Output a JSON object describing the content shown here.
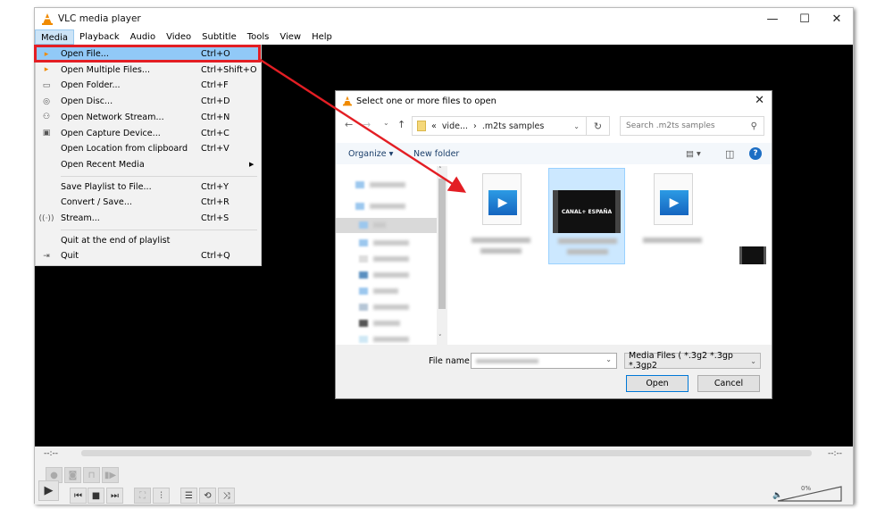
{
  "window": {
    "title": "VLC media player",
    "controls": {
      "minimize": "—",
      "maximize": "☐",
      "close": "✕"
    }
  },
  "menubar": [
    {
      "label": "Media",
      "active": true
    },
    {
      "label": "Playback"
    },
    {
      "label": "Audio"
    },
    {
      "label": "Video"
    },
    {
      "label": "Subtitle"
    },
    {
      "label": "Tools"
    },
    {
      "label": "View"
    },
    {
      "label": "Help"
    }
  ],
  "media_menu": [
    {
      "label": "Open File...",
      "shortcut": "Ctrl+O",
      "icon": "file-play-icon",
      "glyph": "▸",
      "highlighted": true
    },
    {
      "label": "Open Multiple Files...",
      "shortcut": "Ctrl+Shift+O",
      "icon": "files-play-icon",
      "glyph": "▸"
    },
    {
      "label": "Open Folder...",
      "shortcut": "Ctrl+F",
      "icon": "folder-icon",
      "glyph": "▭"
    },
    {
      "label": "Open Disc...",
      "shortcut": "Ctrl+D",
      "icon": "disc-icon",
      "glyph": "◎"
    },
    {
      "label": "Open Network Stream...",
      "shortcut": "Ctrl+N",
      "icon": "network-icon",
      "glyph": "⚇"
    },
    {
      "label": "Open Capture Device...",
      "shortcut": "Ctrl+C",
      "icon": "capture-device-icon",
      "glyph": "▣"
    },
    {
      "label": "Open Location from clipboard",
      "shortcut": "Ctrl+V",
      "icon": "",
      "glyph": ""
    },
    {
      "label": "Open Recent Media",
      "shortcut": "",
      "icon": "",
      "glyph": "",
      "submenu": true
    },
    {
      "separator": true
    },
    {
      "label": "Save Playlist to File...",
      "shortcut": "Ctrl+Y",
      "icon": "",
      "glyph": ""
    },
    {
      "label": "Convert / Save...",
      "shortcut": "Ctrl+R",
      "icon": "",
      "glyph": ""
    },
    {
      "label": "Stream...",
      "shortcut": "Ctrl+S",
      "icon": "stream-icon",
      "glyph": "((·))"
    },
    {
      "separator": true
    },
    {
      "label": "Quit at the end of playlist",
      "shortcut": "",
      "icon": "",
      "glyph": ""
    },
    {
      "label": "Quit",
      "shortcut": "Ctrl+Q",
      "icon": "quit-icon",
      "glyph": "⇥"
    }
  ],
  "submenu_arrow": "▶",
  "dialog": {
    "title": "Select one or more files to open",
    "close": "✕",
    "nav": {
      "back": "←",
      "forward": "→",
      "recent": "⌄",
      "up": "↑"
    },
    "address": {
      "prefix": "«",
      "crumb1": "vide...",
      "sep": "›",
      "crumb2": ".m2ts samples",
      "chevron": "⌄"
    },
    "refresh": "↻",
    "search_placeholder": "Search .m2ts samples",
    "search_glyph": "⚲",
    "toolbar": {
      "organize": "Organize ▾",
      "new_folder": "New folder",
      "view": "▤ ▾",
      "pane": "◫",
      "help": "?"
    },
    "sidebar": {
      "scroll_up": "˄",
      "scroll_down": "˅"
    },
    "files": [
      {
        "type": "video-file",
        "selected": false
      },
      {
        "type": "video-thumbnail",
        "selected": true,
        "thumbnail_text": "CANAL+ ESPAÑA"
      },
      {
        "type": "video-file",
        "selected": false
      },
      {
        "type": "video-thumbnail-small",
        "selected": false
      }
    ],
    "file_name_label": "File name:",
    "file_type_value": "Media Files ( *.3g2 *.3gp *.3gp2",
    "chevron": "⌄",
    "open_label": "Open",
    "cancel_label": "Cancel"
  },
  "player": {
    "time_elapsed": "--:--",
    "time_total": "--:--",
    "volume_label": "0%",
    "buttons": {
      "record": "●",
      "snapshot": "◙",
      "loop_ab": "⊓",
      "frame": "▮▶",
      "play": "▶",
      "prev": "⏮",
      "stop": "■",
      "next": "⏭",
      "fullscreen": "⛶",
      "ext_settings": "⫶",
      "playlist": "☰",
      "loop": "⟲",
      "random": "⤨"
    },
    "speaker": "🔈"
  },
  "annotation": {
    "color": "#e31e24"
  }
}
